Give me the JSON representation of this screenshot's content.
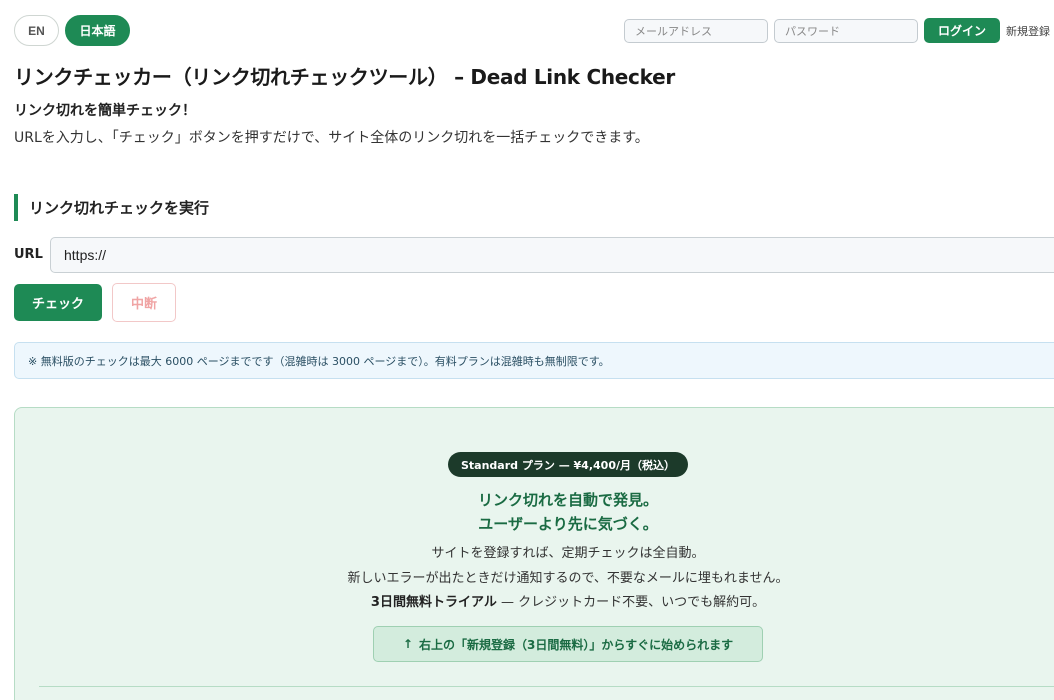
{
  "header": {
    "lang_en": "EN",
    "lang_ja": "日本語",
    "email_placeholder": "メールアドレス",
    "password_placeholder": "パスワード",
    "login_label": "ログイン",
    "register_label": "新規登録"
  },
  "main": {
    "title": "リンクチェッカー（リンク切れチェックツール） – Dead Link Checker",
    "tagline": "リンク切れを簡単チェック！",
    "description": "URLを入力し、「チェック」ボタンを押すだけで、サイト全体のリンク切れを一括チェックできます。",
    "section_heading": "リンク切れチェックを実行",
    "url_label": "URL",
    "url_value": "https://",
    "check_label": "チェック",
    "stop_label": "中断",
    "notice": "※ 無料版のチェックは最大 6000 ページまでです（混雑時は 3000 ページまで）。有料プランは混雑時も無制限です。"
  },
  "promo": {
    "plan_badge": "Standard プラン — ¥4,400/月（税込）",
    "headline_1": "リンク切れを自動で発見。",
    "headline_2": "ユーザーより先に気づく。",
    "body_1": "サイトを登録すれば、定期チェックは全自動。",
    "body_2": "新しいエラーが出たときだけ通知するので、不要なメールに埋もれません。",
    "trial_bold": "3日間無料トライアル",
    "trial_rest": " — クレジットカード不要、いつでも解約可。",
    "cta_arrow": "↑",
    "cta_hint": "右上の「新規登録（3日間無料）」からすぐに始められます"
  },
  "colors": {
    "accent": "#1e8a55",
    "promo_bg": "#e9f5ee",
    "notice_bg": "#eef7fd",
    "badge_bg": "#1c3a2a"
  },
  "icons": {
    "cta": "arrow-up-icon"
  }
}
